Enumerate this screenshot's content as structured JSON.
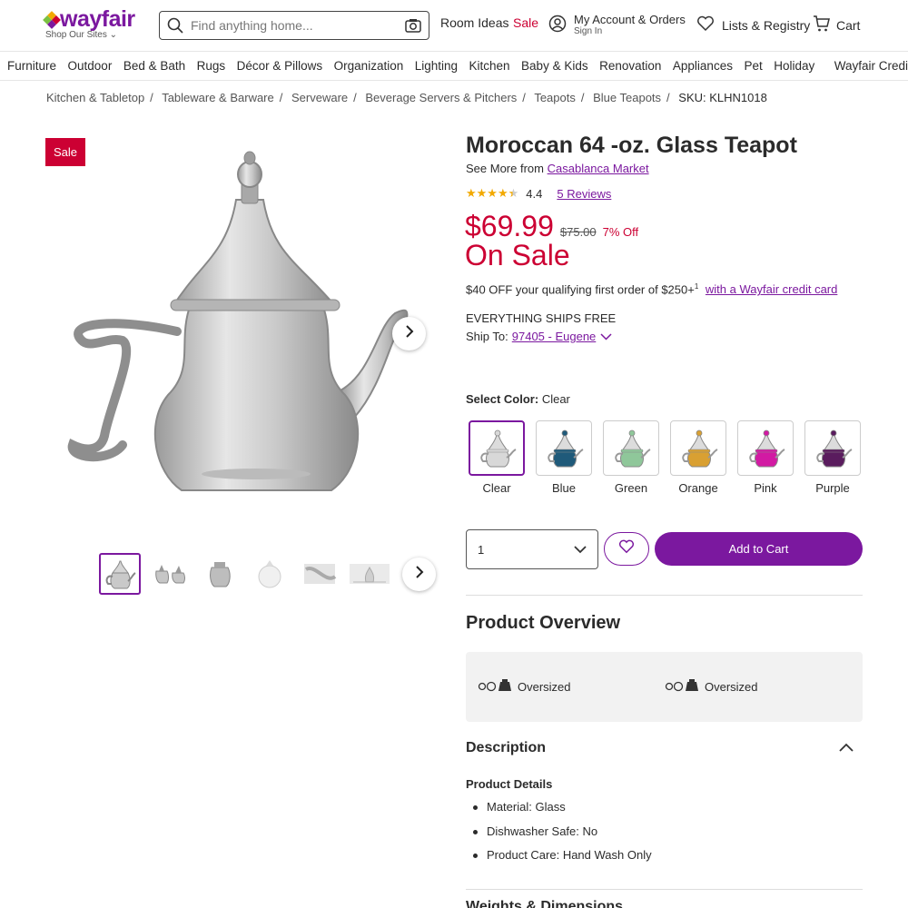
{
  "colors": {
    "brand": "#7b189f",
    "sale": "#cc0033",
    "star": "#f2a900"
  },
  "header": {
    "logo": "wayfair",
    "shop_sites": "Shop Our Sites",
    "search_placeholder": "Find anything home...",
    "room_ideas": "Room Ideas",
    "sale": "Sale",
    "account_title": "My Account & Orders",
    "account_sub": "Sign In",
    "lists": "Lists & Registry",
    "cart": "Cart"
  },
  "categories": [
    "Furniture",
    "Outdoor",
    "Bed & Bath",
    "Rugs",
    "Décor & Pillows",
    "Organization",
    "Lighting",
    "Kitchen",
    "Baby & Kids",
    "Renovation",
    "Appliances",
    "Pet",
    "Holiday"
  ],
  "credit_card_link": "Wayfair Credit Card",
  "breadcrumbs": [
    "Kitchen & Tabletop",
    "Tableware & Barware",
    "Serveware",
    "Beverage Servers & Pitchers",
    "Teapots",
    "Blue Teapots"
  ],
  "sku": "SKU: KLHN1018",
  "gallery": {
    "badge": "Sale",
    "thumb_count": 6
  },
  "product": {
    "title": "Moroccan 64 -oz. Glass Teapot",
    "see_more_prefix": "See More from",
    "brand": "Casablanca Market",
    "rating": "4.4",
    "rating_value": 4.4,
    "reviews": "5 Reviews",
    "price": "$69.99",
    "was_price": "$75.00",
    "discount": "7% Off",
    "on_sale": "On Sale",
    "promo_text": "$40 OFF your qualifying first order of $250+",
    "promo_sup": "1",
    "promo_link": "with a Wayfair credit card",
    "ships_free": "EVERYTHING SHIPS FREE",
    "ship_to_label": "Ship To:",
    "ship_to": "97405 - Eugene"
  },
  "color_select": {
    "label": "Select Color:",
    "selected": "Clear",
    "options": [
      {
        "name": "Clear",
        "color": "#d8d8d8"
      },
      {
        "name": "Blue",
        "color": "#1f5a7a"
      },
      {
        "name": "Green",
        "color": "#8fc79a"
      },
      {
        "name": "Orange",
        "color": "#d9a032"
      },
      {
        "name": "Pink",
        "color": "#d21aa3"
      },
      {
        "name": "Purple",
        "color": "#5a1c5e"
      }
    ]
  },
  "purchase": {
    "quantity": "1",
    "add_to_cart": "Add to Cart"
  },
  "overview": {
    "heading": "Product Overview",
    "items": [
      "Oversized",
      "Oversized"
    ]
  },
  "description": {
    "heading": "Description",
    "details_heading": "Product Details",
    "details": [
      "Material: Glass",
      "Dishwasher Safe: No",
      "Product Care: Hand Wash Only"
    ],
    "next_heading": "Weights & Dimensions"
  }
}
